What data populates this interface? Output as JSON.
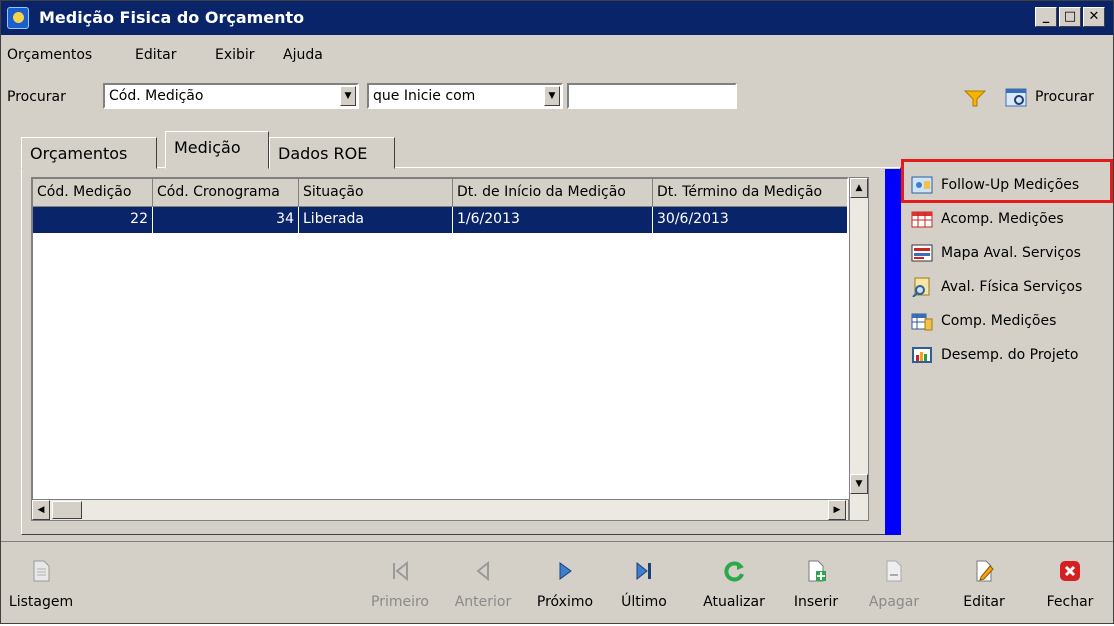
{
  "window": {
    "title": "Medição Fisica do Orçamento",
    "min": "_",
    "max": "□",
    "close": "✕"
  },
  "menu": [
    "Orçamentos",
    "Editar",
    "Exibir",
    "Ajuda"
  ],
  "search": {
    "label": "Procurar",
    "field_value": "Cód. Medição",
    "operator_value": "que Inicie com",
    "text_value": "",
    "search_button": "Procurar"
  },
  "tabs": [
    "Orçamentos",
    "Medição",
    "Dados ROE"
  ],
  "grid": {
    "columns": [
      "Cód. Medição",
      "Cód. Cronograma",
      "Situação",
      "Dt. de Início da Medição",
      "Dt. Término da Medição"
    ],
    "rows": [
      [
        "22",
        "34",
        "Liberada",
        "1/6/2013",
        "30/6/2013"
      ]
    ]
  },
  "side_links": [
    "Follow-Up Medições",
    "Acomp. Medições",
    "Mapa Aval. Serviços",
    "Aval. Física Serviços",
    "Comp. Medições",
    "Desemp. do Projeto"
  ],
  "toolbar": [
    {
      "label": "Listagem",
      "icon": "list-document-icon"
    },
    {
      "label": "Primeiro",
      "icon": "first-record-icon"
    },
    {
      "label": "Anterior",
      "icon": "previous-record-icon"
    },
    {
      "label": "Próximo",
      "icon": "next-record-icon"
    },
    {
      "label": "Último",
      "icon": "last-record-icon"
    },
    {
      "label": "Atualizar",
      "icon": "refresh-icon"
    },
    {
      "label": "Inserir",
      "icon": "insert-document-icon"
    },
    {
      "label": "Apagar",
      "icon": "delete-document-icon"
    },
    {
      "label": "Editar",
      "icon": "edit-document-icon"
    },
    {
      "label": "Fechar",
      "icon": "close-red-icon"
    }
  ],
  "colors": {
    "title_bar": "#0a246a",
    "selection": "#0a246a",
    "highlight_box": "#e21b1b",
    "side_bar": "#0000ff"
  }
}
